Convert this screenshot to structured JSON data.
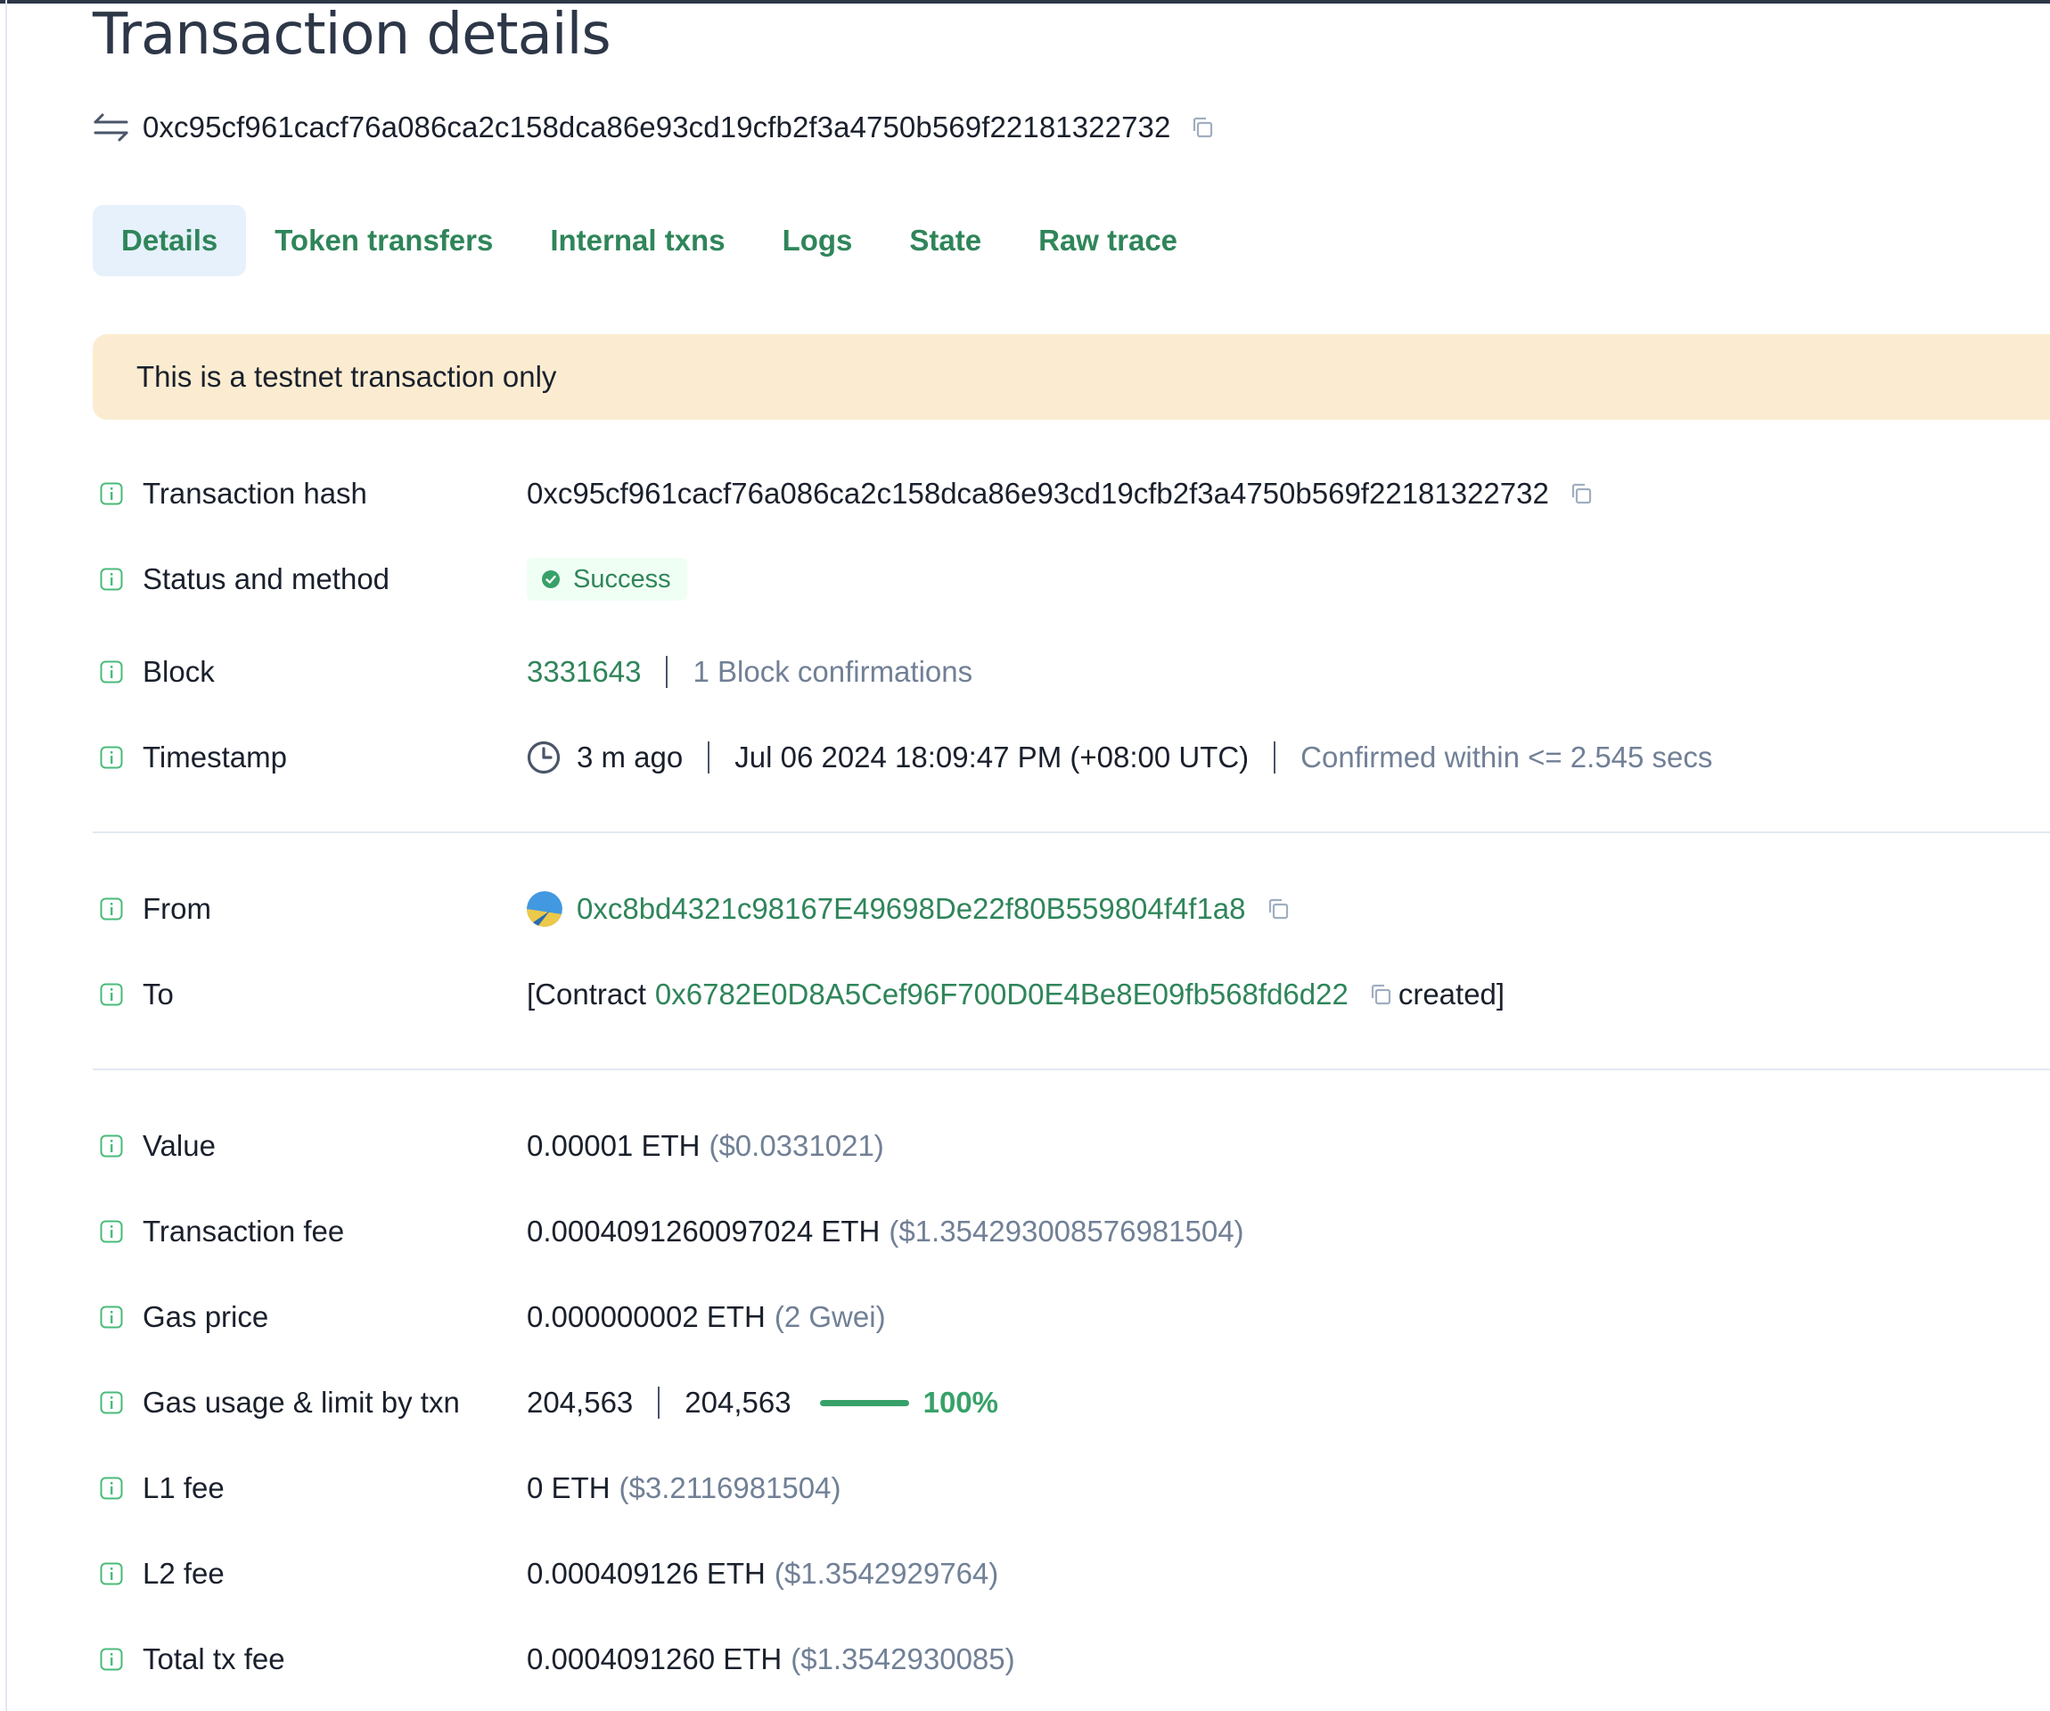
{
  "page": {
    "title": "Transaction details",
    "tx_hash": "0xc95cf961cacf76a086ca2c158dca86e93cd19cfb2f3a4750b569f22181322732"
  },
  "tabs": [
    {
      "label": "Details",
      "active": true
    },
    {
      "label": "Token transfers"
    },
    {
      "label": "Internal txns"
    },
    {
      "label": "Logs"
    },
    {
      "label": "State"
    },
    {
      "label": "Raw trace"
    }
  ],
  "banner": "This is a testnet transaction only",
  "details": {
    "tx_hash": {
      "label": "Transaction hash",
      "value": "0xc95cf961cacf76a086ca2c158dca86e93cd19cfb2f3a4750b569f22181322732"
    },
    "status": {
      "label": "Status and method",
      "value": "Success"
    },
    "block": {
      "label": "Block",
      "number": "3331643",
      "confirmations": "1 Block confirmations"
    },
    "timestamp": {
      "label": "Timestamp",
      "ago": "3 m ago",
      "datetime": "Jul 06 2024 18:09:47 PM (+08:00 UTC)",
      "confirmed": "Confirmed within <= 2.545 secs"
    },
    "from": {
      "label": "From",
      "address": "0xc8bd4321c98167E49698De22f80B559804f4f1a8"
    },
    "to": {
      "label": "To",
      "prefix": "[Contract",
      "address": "0x6782E0D8A5Cef96F700D0E4Be8E09fb568fd6d22",
      "suffix": "created]"
    },
    "value": {
      "label": "Value",
      "amount": "0.00001 ETH",
      "usd": "($0.0331021)"
    },
    "tx_fee": {
      "label": "Transaction fee",
      "amount": "0.0004091260097024 ETH",
      "usd": "($1.354293008576981504)"
    },
    "gas_price": {
      "label": "Gas price",
      "amount": "0.000000002 ETH",
      "gwei": "(2 Gwei)"
    },
    "gas_usage": {
      "label": "Gas usage & limit by txn",
      "used": "204,563",
      "limit": "204,563",
      "percent": "100%",
      "fraction": 1.0
    },
    "l1_fee": {
      "label": "L1 fee",
      "amount": "0 ETH",
      "usd": "($3.2116981504)"
    },
    "l2_fee": {
      "label": "L2 fee",
      "amount": "0.000409126 ETH",
      "usd": "($1.3542929764)"
    },
    "total_fee": {
      "label": "Total tx fee",
      "amount": "0.0004091260 ETH",
      "usd": "($1.3542930085)"
    }
  },
  "colors": {
    "accent": "#2f855a",
    "banner_bg": "#fbecd1",
    "active_tab_bg": "#e6f1fb",
    "muted": "#718096",
    "success": "#38a169"
  },
  "icons": [
    "transfer-arrows-icon",
    "copy-icon",
    "info-icon",
    "check-circle-icon",
    "clock-icon",
    "address-avatar"
  ]
}
